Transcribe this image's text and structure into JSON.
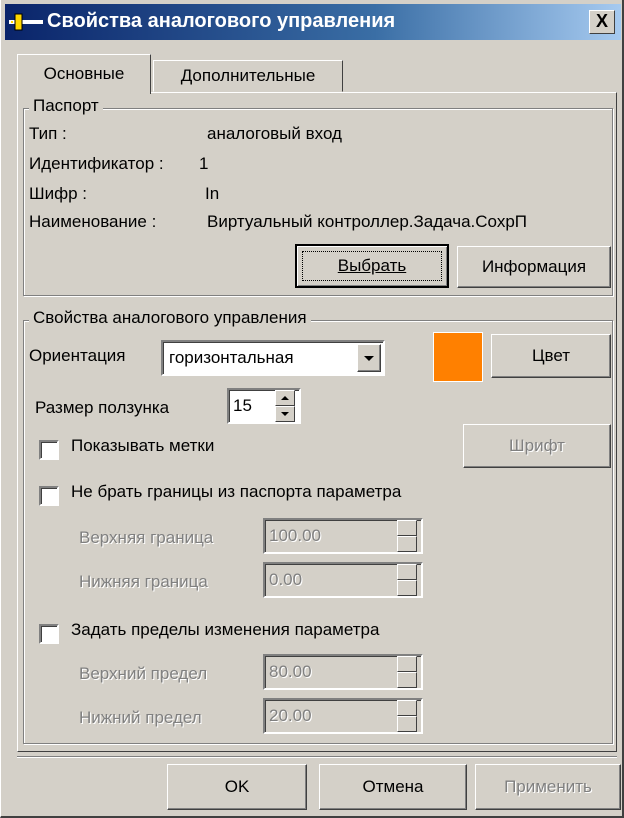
{
  "window": {
    "title": "Свойства аналогового управления",
    "close_glyph": "X",
    "title_bar_colors": [
      "#0a246a",
      "#a6caf0"
    ]
  },
  "tabs": [
    {
      "label": "Основные",
      "active": true
    },
    {
      "label": "Дополнительные",
      "active": false
    }
  ],
  "passport": {
    "title": "Паспорт",
    "rows": [
      {
        "label": "Тип :",
        "value": "аналоговый вход"
      },
      {
        "label": "Идентификатор :",
        "value": "1"
      },
      {
        "label": "Шифр :",
        "value": "In"
      },
      {
        "label": "Наименование :",
        "value": "Виртуальный контроллер.Задача.СохрП"
      }
    ],
    "select_button": "Выбрать",
    "info_button": "Информация"
  },
  "analog": {
    "title": "Свойства аналогового управления",
    "orientation_label": "Ориентация",
    "orientation_value": "горизонтальная",
    "color_swatch": "#ff8000",
    "color_button": "Цвет",
    "slider_size_label": "Размер ползунка",
    "slider_size_value": "15",
    "show_marks_label": "Показывать метки",
    "show_marks_checked": false,
    "font_button": "Шрифт",
    "no_bounds_label": "Не брать границы из паспорта параметра",
    "no_bounds_checked": false,
    "upper_bound_label": "Верхняя граница",
    "upper_bound_value": "100.00",
    "lower_bound_label": "Нижняя граница",
    "lower_bound_value": "0.00",
    "set_limits_label": "Задать пределы изменения параметра",
    "set_limits_checked": false,
    "upper_limit_label": "Верхний предел",
    "upper_limit_value": "80.00",
    "lower_limit_label": "Нижний предел",
    "lower_limit_value": "20.00"
  },
  "footer": {
    "ok": "OK",
    "cancel": "Отмена",
    "apply": "Применить"
  }
}
